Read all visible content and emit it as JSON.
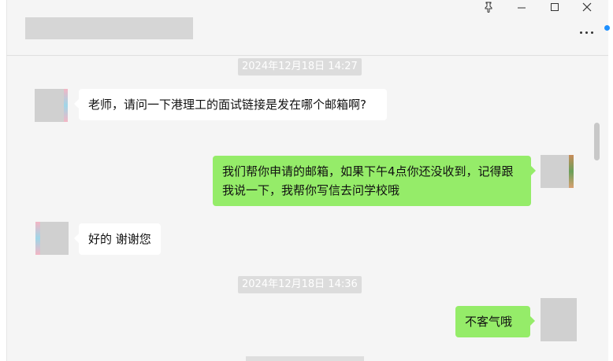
{
  "window": {
    "pin_icon": "pin-icon",
    "minimize_icon": "minimize-icon",
    "maximize_icon": "maximize-icon",
    "close_icon": "close-icon",
    "more_icon": "more-icon"
  },
  "messages": [
    {
      "type": "time",
      "text": "2024年12月18日 14:27"
    },
    {
      "type": "received",
      "text": "老师，请问一下港理工的面试链接是发在哪个邮箱啊?"
    },
    {
      "type": "sent",
      "text": "我们帮你申请的邮箱，如果下午4点你还没收到，记得跟我说一下，我帮你写信去问学校哦"
    },
    {
      "type": "received",
      "text": "好的 谢谢您"
    },
    {
      "type": "time",
      "text": "2024年12月18日 14:36"
    },
    {
      "type": "sent",
      "text": "不客气哦"
    }
  ],
  "colors": {
    "sent_bubble": "#95ec69",
    "received_bubble": "#ffffff",
    "background": "#f5f5f5"
  }
}
